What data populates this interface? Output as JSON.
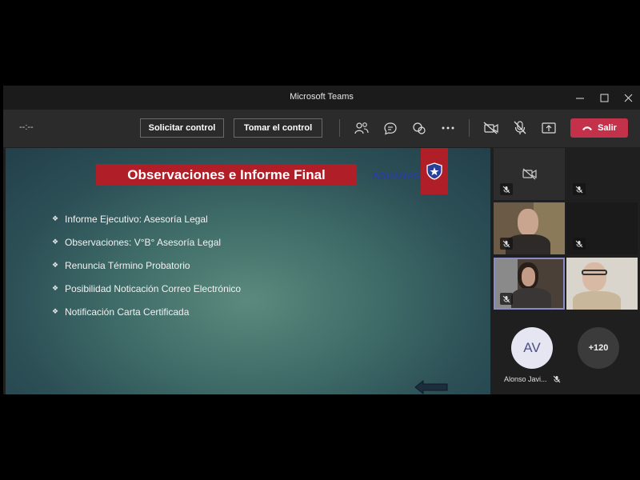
{
  "window": {
    "title": "Microsoft Teams"
  },
  "toolbar": {
    "timer": "--:--",
    "request_control": "Solicitar control",
    "take_control": "Tomar el control",
    "leave": "Salir"
  },
  "slide": {
    "title": "Observaciones e Informe Final",
    "logo_text": "ADUANAS",
    "bullets": [
      "Informe Ejecutivo: Asesoría Legal",
      "Observaciones: V°B° Asesoría Legal",
      "Renuncia Término Probatorio",
      "Posibilidad Noticación Correo Electrónico",
      "Notificación  Carta Certificada"
    ]
  },
  "participants": {
    "avatar_initials": "AV",
    "avatar_name": "Alonso Javi...",
    "overflow_count": "+120"
  },
  "colors": {
    "leave": "#c4314b",
    "slide_red": "#b01f28",
    "active_border": "#8b8cc7"
  }
}
